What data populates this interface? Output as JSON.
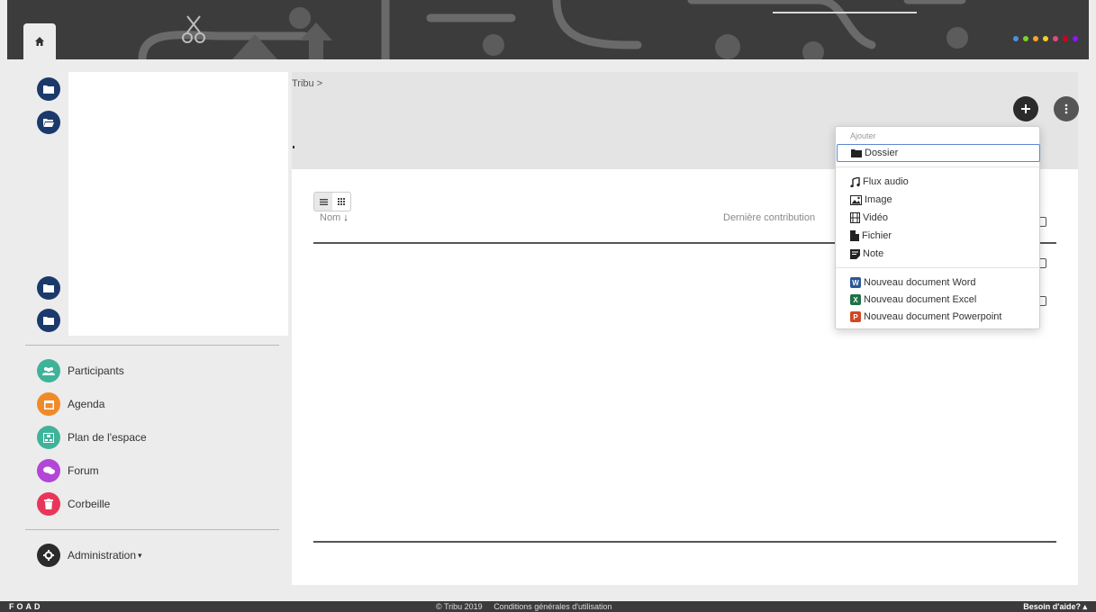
{
  "header": {
    "home_icon": "home-icon",
    "dot_colors": [
      "#4a90e2",
      "#7ed321",
      "#f5a623",
      "#f5d020",
      "#e24a7e",
      "#d0021b",
      "#9013fe"
    ]
  },
  "sidebar": {
    "nav": [
      {
        "label": "Participants",
        "icon": "users-icon",
        "color": "#3fb39a"
      },
      {
        "label": "Agenda",
        "icon": "calendar-icon",
        "color": "#f08a28"
      },
      {
        "label": "Plan de l'espace",
        "icon": "sitemap-icon",
        "color": "#3fb39a"
      },
      {
        "label": "Forum",
        "icon": "chat-icon",
        "color": "#b146d8"
      },
      {
        "label": "Corbeille",
        "icon": "trash-icon",
        "color": "#e8365b"
      }
    ],
    "admin_label": "Administration",
    "admin_caret": "▾"
  },
  "main": {
    "breadcrumb": "Tribu >",
    "columns": {
      "name": "Nom",
      "sort_arrow": "↓",
      "last": "Dernière contribution"
    }
  },
  "dropdown": {
    "header": "Ajouter",
    "folder": "Dossier",
    "media": [
      {
        "label": "Flux audio",
        "icon": "music-icon"
      },
      {
        "label": "Image",
        "icon": "image-icon"
      },
      {
        "label": "Vidéo",
        "icon": "film-icon"
      },
      {
        "label": "Fichier",
        "icon": "file-icon"
      },
      {
        "label": "Note",
        "icon": "note-icon"
      }
    ],
    "office": [
      {
        "label": "Nouveau document Word",
        "badge": "W",
        "color": "#2b5797"
      },
      {
        "label": "Nouveau document Excel",
        "badge": "X",
        "color": "#1e7145"
      },
      {
        "label": "Nouveau document Powerpoint",
        "badge": "P",
        "color": "#d24726"
      }
    ]
  },
  "footer": {
    "brand": "FOAD",
    "copyright": "© Tribu 2019",
    "terms": "Conditions générales d'utilisation",
    "help": "Besoin d'aide?",
    "help_caret": "▴"
  }
}
